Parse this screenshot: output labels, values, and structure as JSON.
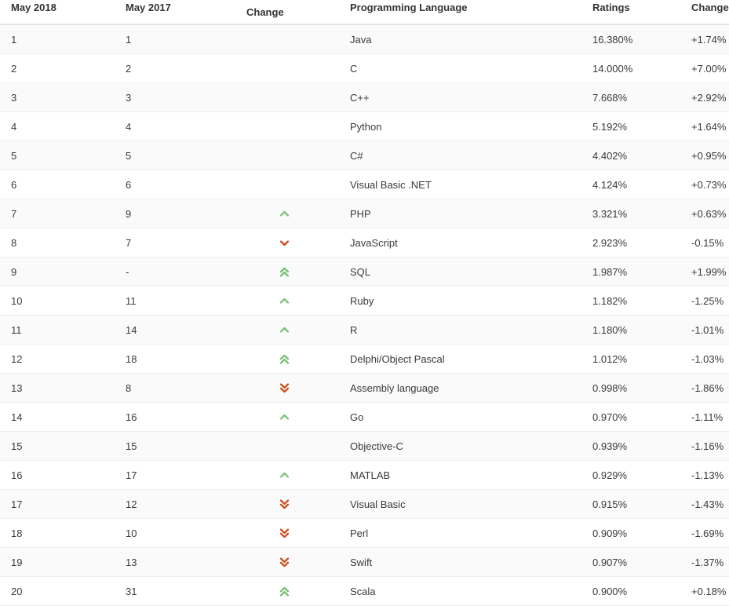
{
  "table": {
    "headers": {
      "rank_new": "May 2018",
      "rank_old": "May 2017",
      "change": "Change",
      "language": "Programming Language",
      "ratings": "Ratings",
      "delta": "Change"
    },
    "colors": {
      "up": "#7ac27a",
      "down": "#cc4b16",
      "header_text": "#333333",
      "cell_text": "#3a3a3a",
      "stripe": "#fafafa",
      "row_border": "#eeeeee",
      "header_border": "#e4e4e4"
    },
    "rows": [
      {
        "rank_new": "1",
        "rank_old": "1",
        "change": "none",
        "language": "Java",
        "ratings": "16.380%",
        "delta": "+1.74%"
      },
      {
        "rank_new": "2",
        "rank_old": "2",
        "change": "none",
        "language": "C",
        "ratings": "14.000%",
        "delta": "+7.00%"
      },
      {
        "rank_new": "3",
        "rank_old": "3",
        "change": "none",
        "language": "C++",
        "ratings": "7.668%",
        "delta": "+2.92%"
      },
      {
        "rank_new": "4",
        "rank_old": "4",
        "change": "none",
        "language": "Python",
        "ratings": "5.192%",
        "delta": "+1.64%"
      },
      {
        "rank_new": "5",
        "rank_old": "5",
        "change": "none",
        "language": "C#",
        "ratings": "4.402%",
        "delta": "+0.95%"
      },
      {
        "rank_new": "6",
        "rank_old": "6",
        "change": "none",
        "language": "Visual Basic .NET",
        "ratings": "4.124%",
        "delta": "+0.73%"
      },
      {
        "rank_new": "7",
        "rank_old": "9",
        "change": "up",
        "language": "PHP",
        "ratings": "3.321%",
        "delta": "+0.63%"
      },
      {
        "rank_new": "8",
        "rank_old": "7",
        "change": "down",
        "language": "JavaScript",
        "ratings": "2.923%",
        "delta": "-0.15%"
      },
      {
        "rank_new": "9",
        "rank_old": "-",
        "change": "up-double",
        "language": "SQL",
        "ratings": "1.987%",
        "delta": "+1.99%"
      },
      {
        "rank_new": "10",
        "rank_old": "11",
        "change": "up",
        "language": "Ruby",
        "ratings": "1.182%",
        "delta": "-1.25%"
      },
      {
        "rank_new": "11",
        "rank_old": "14",
        "change": "up",
        "language": "R",
        "ratings": "1.180%",
        "delta": "-1.01%"
      },
      {
        "rank_new": "12",
        "rank_old": "18",
        "change": "up-double",
        "language": "Delphi/Object Pascal",
        "ratings": "1.012%",
        "delta": "-1.03%"
      },
      {
        "rank_new": "13",
        "rank_old": "8",
        "change": "down-double",
        "language": "Assembly language",
        "ratings": "0.998%",
        "delta": "-1.86%"
      },
      {
        "rank_new": "14",
        "rank_old": "16",
        "change": "up",
        "language": "Go",
        "ratings": "0.970%",
        "delta": "-1.11%"
      },
      {
        "rank_new": "15",
        "rank_old": "15",
        "change": "none",
        "language": "Objective-C",
        "ratings": "0.939%",
        "delta": "-1.16%"
      },
      {
        "rank_new": "16",
        "rank_old": "17",
        "change": "up",
        "language": "MATLAB",
        "ratings": "0.929%",
        "delta": "-1.13%"
      },
      {
        "rank_new": "17",
        "rank_old": "12",
        "change": "down-double",
        "language": "Visual Basic",
        "ratings": "0.915%",
        "delta": "-1.43%"
      },
      {
        "rank_new": "18",
        "rank_old": "10",
        "change": "down-double",
        "language": "Perl",
        "ratings": "0.909%",
        "delta": "-1.69%"
      },
      {
        "rank_new": "19",
        "rank_old": "13",
        "change": "down-double",
        "language": "Swift",
        "ratings": "0.907%",
        "delta": "-1.37%"
      },
      {
        "rank_new": "20",
        "rank_old": "31",
        "change": "up-double",
        "language": "Scala",
        "ratings": "0.900%",
        "delta": "+0.18%"
      }
    ]
  }
}
